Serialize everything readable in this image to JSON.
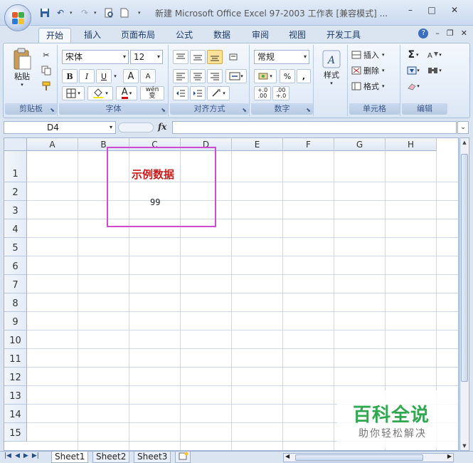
{
  "window": {
    "title": "新建 Microsoft Office Excel 97-2003 工作表 [兼容模式] ...",
    "controls": [
      "–",
      "□",
      "✕"
    ]
  },
  "quick_access": [
    "save-icon",
    "undo-icon",
    "redo-icon",
    "print-preview-icon",
    "new-icon"
  ],
  "ribbon_tabs": [
    "开始",
    "插入",
    "页面布局",
    "公式",
    "数据",
    "审阅",
    "视图",
    "开发工具"
  ],
  "ribbon": {
    "clipboard": {
      "paste_label": "粘贴",
      "group_label": "剪贴板"
    },
    "font": {
      "font_name": "宋体",
      "font_size": "12",
      "group_label": "字体",
      "bold": "B",
      "italic": "I",
      "underline": "U",
      "grow": "A",
      "shrink": "A",
      "color_letter": "A",
      "phonetic": "wén\n变"
    },
    "alignment": {
      "group_label": "对齐方式"
    },
    "number": {
      "format": "常规",
      "percent": "%",
      "comma": ",",
      "inc_decimal": "+.0\n.00",
      "dec_decimal": ".00\n+.0",
      "group_label": "数字"
    },
    "styles": {
      "label": "样式"
    },
    "cells": {
      "insert": "插入",
      "delete": "删除",
      "format": "格式",
      "group_label": "单元格"
    },
    "editing": {
      "group_label": "编辑",
      "sum": "Σ"
    }
  },
  "formula_bar": {
    "name_box": "D4",
    "fx": "fx",
    "content": ""
  },
  "grid": {
    "columns": [
      "A",
      "B",
      "C",
      "D",
      "E",
      "F",
      "G",
      "H"
    ],
    "rows": [
      "1",
      "2",
      "3",
      "4",
      "5",
      "6",
      "7",
      "8",
      "9",
      "10",
      "11",
      "12",
      "13",
      "14",
      "15"
    ],
    "cells": {
      "C1": "示例数据",
      "C2": "99"
    },
    "colors": {
      "title_text": "#cc1a1a",
      "highlight_border": "#d14bd1"
    }
  },
  "sheets": [
    "Sheet1",
    "Sheet2",
    "Sheet3"
  ],
  "active_sheet": "Sheet1",
  "watermark": {
    "main": "百科全说",
    "sub": "助你轻松解决"
  }
}
